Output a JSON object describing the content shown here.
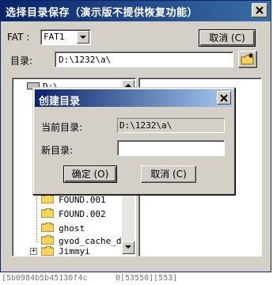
{
  "window": {
    "title": "选择目录保存（演示版不提供恢复功能）"
  },
  "fat": {
    "label": "FAT :",
    "value": "FAT1"
  },
  "buttons": {
    "cancel": "取消 (C)"
  },
  "path": {
    "label": "目录:",
    "value": "D:\\1232\\a\\"
  },
  "tree": {
    "items": [
      {
        "label": "D:\\"
      },
      {
        "label": "FOUND.001"
      },
      {
        "label": "FOUND.002"
      },
      {
        "label": "ghost"
      },
      {
        "label": "gvod_cache_da"
      },
      {
        "label": "Jimmyi"
      }
    ]
  },
  "dialog": {
    "title": "创建目录",
    "current_label": "当前目录:",
    "current_value": "D:\\1232\\a\\",
    "new_label": "新目录:",
    "new_value": "",
    "ok": "确定 (O)",
    "cancel": "取消 (C)"
  },
  "bottom": {
    "left": "[5b0984b5b45130f4c",
    "right": "0[53550][553]"
  },
  "colors": {
    "title_start": "#0a246a",
    "title_end": "#3a6ea5",
    "face": "#d4d0c8",
    "folder": "#f4d35e"
  }
}
